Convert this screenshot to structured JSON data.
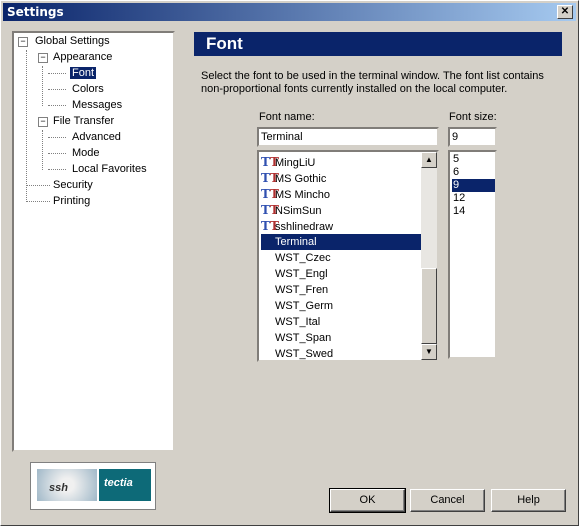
{
  "window": {
    "title": "Settings",
    "close_glyph": "✕"
  },
  "tree": {
    "items": [
      {
        "label": "Global Settings",
        "expander": "−"
      },
      {
        "label": "Appearance",
        "expander": "−"
      },
      {
        "label": "Font"
      },
      {
        "label": "Colors"
      },
      {
        "label": "Messages"
      },
      {
        "label": "File Transfer",
        "expander": "−"
      },
      {
        "label": "Advanced"
      },
      {
        "label": "Mode"
      },
      {
        "label": "Local Favorites"
      },
      {
        "label": "Security"
      },
      {
        "label": "Printing"
      }
    ]
  },
  "logo": {
    "left_text": "ssh",
    "right_text": "tectia"
  },
  "panel": {
    "title": "Font",
    "description": "Select the font to be used in the terminal window. The font list contains non-proportional fonts currently installed on the local computer.",
    "font_name_label": "Font name:",
    "font_size_label": "Font size:",
    "font_name_value": "Terminal",
    "font_size_value": "9",
    "fonts": [
      {
        "name": "MingLiU",
        "icon": "truetype-icon"
      },
      {
        "name": "MS Gothic",
        "icon": "truetype-icon"
      },
      {
        "name": "MS Mincho",
        "icon": "truetype-icon"
      },
      {
        "name": "NSimSun",
        "icon": "truetype-icon"
      },
      {
        "name": "sshlinedraw",
        "icon": "truetype-icon"
      },
      {
        "name": "Terminal",
        "icon": ""
      },
      {
        "name": "WST_Czec",
        "icon": ""
      },
      {
        "name": "WST_Engl",
        "icon": ""
      },
      {
        "name": "WST_Fren",
        "icon": ""
      },
      {
        "name": "WST_Germ",
        "icon": ""
      },
      {
        "name": "WST_Ital",
        "icon": ""
      },
      {
        "name": "WST_Span",
        "icon": ""
      },
      {
        "name": "WST_Swed",
        "icon": ""
      }
    ],
    "sizes": [
      "5",
      "6",
      "9",
      "12",
      "14"
    ]
  },
  "buttons": {
    "ok": "OK",
    "cancel": "Cancel",
    "help": "Help"
  },
  "colors": {
    "selection": "#0a246a",
    "face": "#d4d0c8"
  }
}
